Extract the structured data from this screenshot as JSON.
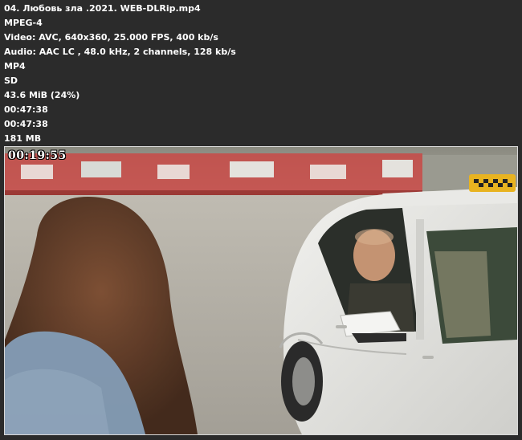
{
  "media_info": {
    "lines": [
      "04. Любовь зла .2021. WEB-DLRip.mp4",
      "MPEG-4",
      "Video: AVC, 640x360, 25.000 FPS, 400 kb/s",
      "Audio: AAC LC , 48.0 kHz, 2 channels, 128 kb/s",
      "MP4",
      "SD",
      "43.6 MiB (24%)",
      "00:47:38",
      "00:47:38",
      "181 MB"
    ]
  },
  "thumbnail": {
    "timestamp": "00:19:55"
  },
  "colors": {
    "background": "#2b2b2b",
    "text": "#ffffff",
    "frame_border": "#d8d8d8"
  }
}
